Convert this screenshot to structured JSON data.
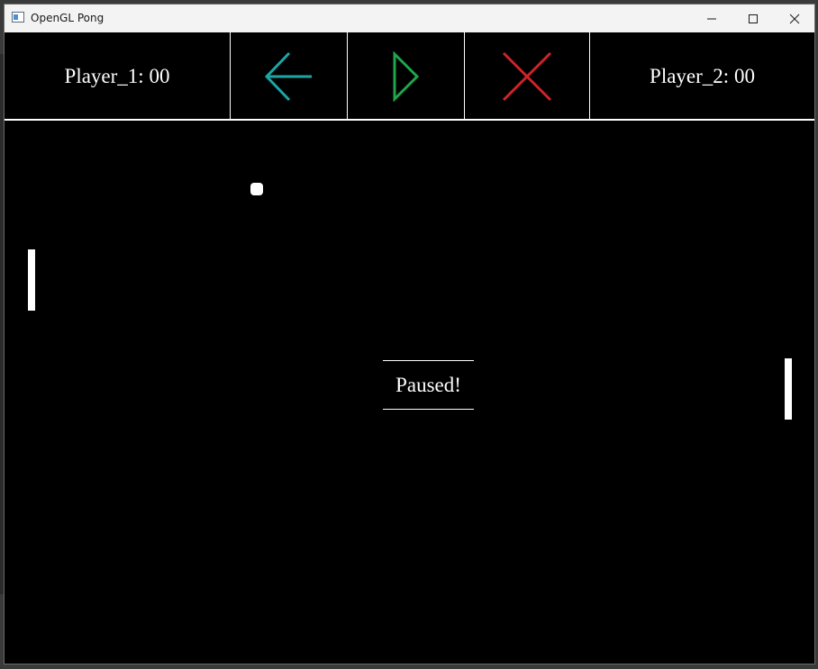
{
  "window": {
    "title": "OpenGL Pong",
    "controls": {
      "minimize_icon": "minimize-icon",
      "maximize_icon": "maximize-icon",
      "close_icon": "close-icon"
    }
  },
  "hud": {
    "player1_score_text": "Player_1: 00",
    "player2_score_text": "Player_2: 00",
    "buttons": [
      {
        "icon": "arrow-left-icon",
        "color": "#1aa7a7"
      },
      {
        "icon": "play-triangle-icon",
        "color": "#1fa64a"
      },
      {
        "icon": "close-x-icon",
        "color": "#d0232a"
      }
    ]
  },
  "game": {
    "status_text": "Paused!",
    "colors": {
      "background": "#000000",
      "foreground": "#ffffff"
    }
  }
}
